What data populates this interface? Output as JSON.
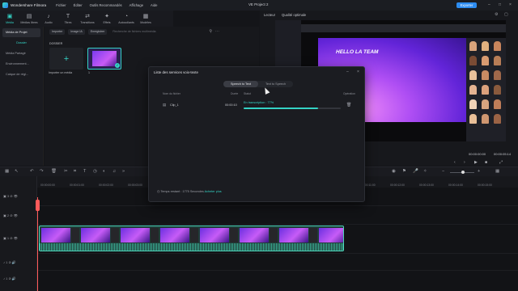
{
  "app": {
    "name": "Wondershare Filmora",
    "project": "VE Project 2",
    "export_label": "Exporter"
  },
  "menu": [
    "Fichier",
    "Éditer",
    "Outils Recommandés",
    "Affichage",
    "Aide"
  ],
  "tabs": [
    {
      "label": "Média",
      "icon": "media-icon"
    },
    {
      "label": "Médias libres",
      "icon": "stock-media-icon"
    },
    {
      "label": "Audio",
      "icon": "audio-icon"
    },
    {
      "label": "Titres",
      "icon": "titles-icon"
    },
    {
      "label": "Transitions",
      "icon": "transitions-icon"
    },
    {
      "label": "Effets",
      "icon": "effects-icon"
    },
    {
      "label": "Autocollants",
      "icon": "stickers-icon"
    },
    {
      "label": "Modèles",
      "icon": "templates-icon"
    }
  ],
  "leftnav": {
    "items": [
      "Média de Projet",
      "Dossier",
      "Média Partagé",
      "Environnement...",
      "Catque de régl..."
    ]
  },
  "media": {
    "import_label": "Importer",
    "image_ia_label": "Image IA",
    "record_label": "Enregistrer",
    "search_placeholder": "Recherche de fichiers multimédia",
    "folder_label": "DOSSIER",
    "import_tile_label": "Importer un média",
    "clip_label": "1"
  },
  "player": {
    "tab_reader": "Lecteur",
    "tab_quality": "Qualité optimale",
    "preview_title": "HELLO LA TEAM",
    "time_current": "00:00:00:00",
    "time_total": "00:00:05:14"
  },
  "timeline": {
    "ticks": [
      "00:00:00:00",
      "00:00:01:00",
      "00:00:02:00",
      "00:00:03:00",
      "00:00:04:00",
      "00:00:05:00",
      "00:00:06:00",
      "00:00:07:00",
      "00:00:08:00",
      "00:00:09:00",
      "00:00:10:00",
      "00:00:11:00",
      "00:00:12:00",
      "00:00:13:00",
      "00:00:14:00",
      "00:00:15:00"
    ],
    "tracks": [
      "3",
      "2",
      "1",
      "1",
      "1"
    ]
  },
  "dialog": {
    "title": "Liste des services voix-texte",
    "toggle": [
      "Speech to Text",
      "Text to Speech"
    ],
    "columns": {
      "name": "Nom du fichier",
      "duration": "Durée",
      "status": "Statut",
      "operation": "Opération"
    },
    "row": {
      "name": "Clip_1",
      "duration": "00:00:10",
      "status": "En transcription : 77%",
      "progress": 0.77
    },
    "footer_text": "Temps restant : 1775 Secondes",
    "footer_link": "Acheter plus"
  }
}
